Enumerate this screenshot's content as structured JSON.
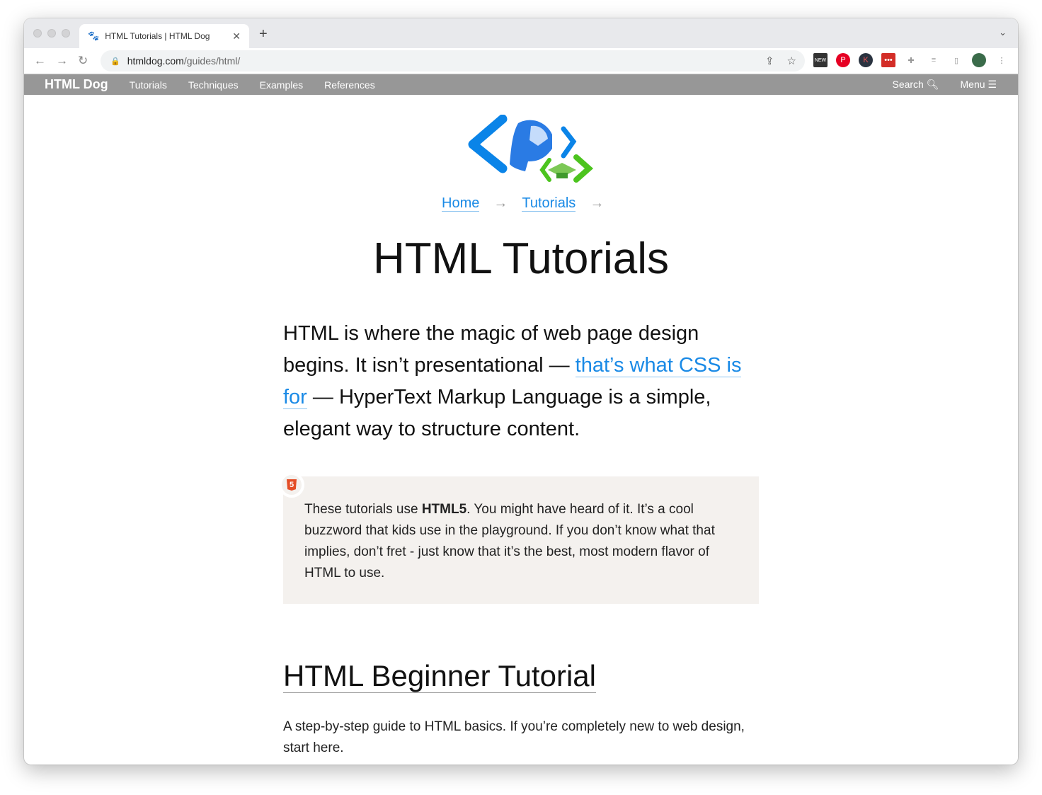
{
  "browser": {
    "tab_title": "HTML Tutorials | HTML Dog",
    "url_host": "htmldog.com",
    "url_path": "/guides/html/",
    "extensions": [
      "news-icon",
      "pinterest-icon",
      "k-icon",
      "lastpass-icon",
      "puzzle-icon",
      "playlist-icon",
      "sidepanel-icon",
      "profile-avatar"
    ]
  },
  "site_nav": {
    "brand": "HTML Dog",
    "items": [
      "Tutorials",
      "Techniques",
      "Examples",
      "References"
    ],
    "search": "Search",
    "menu": "Menu"
  },
  "breadcrumb": {
    "items": [
      "Home",
      "Tutorials"
    ],
    "separator": "→"
  },
  "page": {
    "title": "HTML Tutorials",
    "lead": {
      "p1": "HTML is where the magic of web page design begins. It isn’t presentational — ",
      "link": "that’s what CSS is for",
      "p2": " — ",
      "bold1": "HyperText Markup Language",
      "p3": " is a simple, elegant way to structure ",
      "bold2": "content",
      "p4": "."
    },
    "note": {
      "badge": "5",
      "t1": "These tutorials use ",
      "bold": "HTML5",
      "t2": ". You might have heard of it. It’s a cool buzzword that kids use in the playground. If you don’t know what that implies, don’t fret - just know that it’s the best, most modern flavor of HTML to use."
    },
    "section": {
      "title": "HTML Beginner Tutorial",
      "desc": "A step-by-step guide to HTML basics. If you’re completely new to web design, start here."
    }
  },
  "colors": {
    "nav_bg": "#979797",
    "link": "#1a8ae6",
    "note_bg": "#f4f1ee",
    "html5": "#e44d26"
  }
}
